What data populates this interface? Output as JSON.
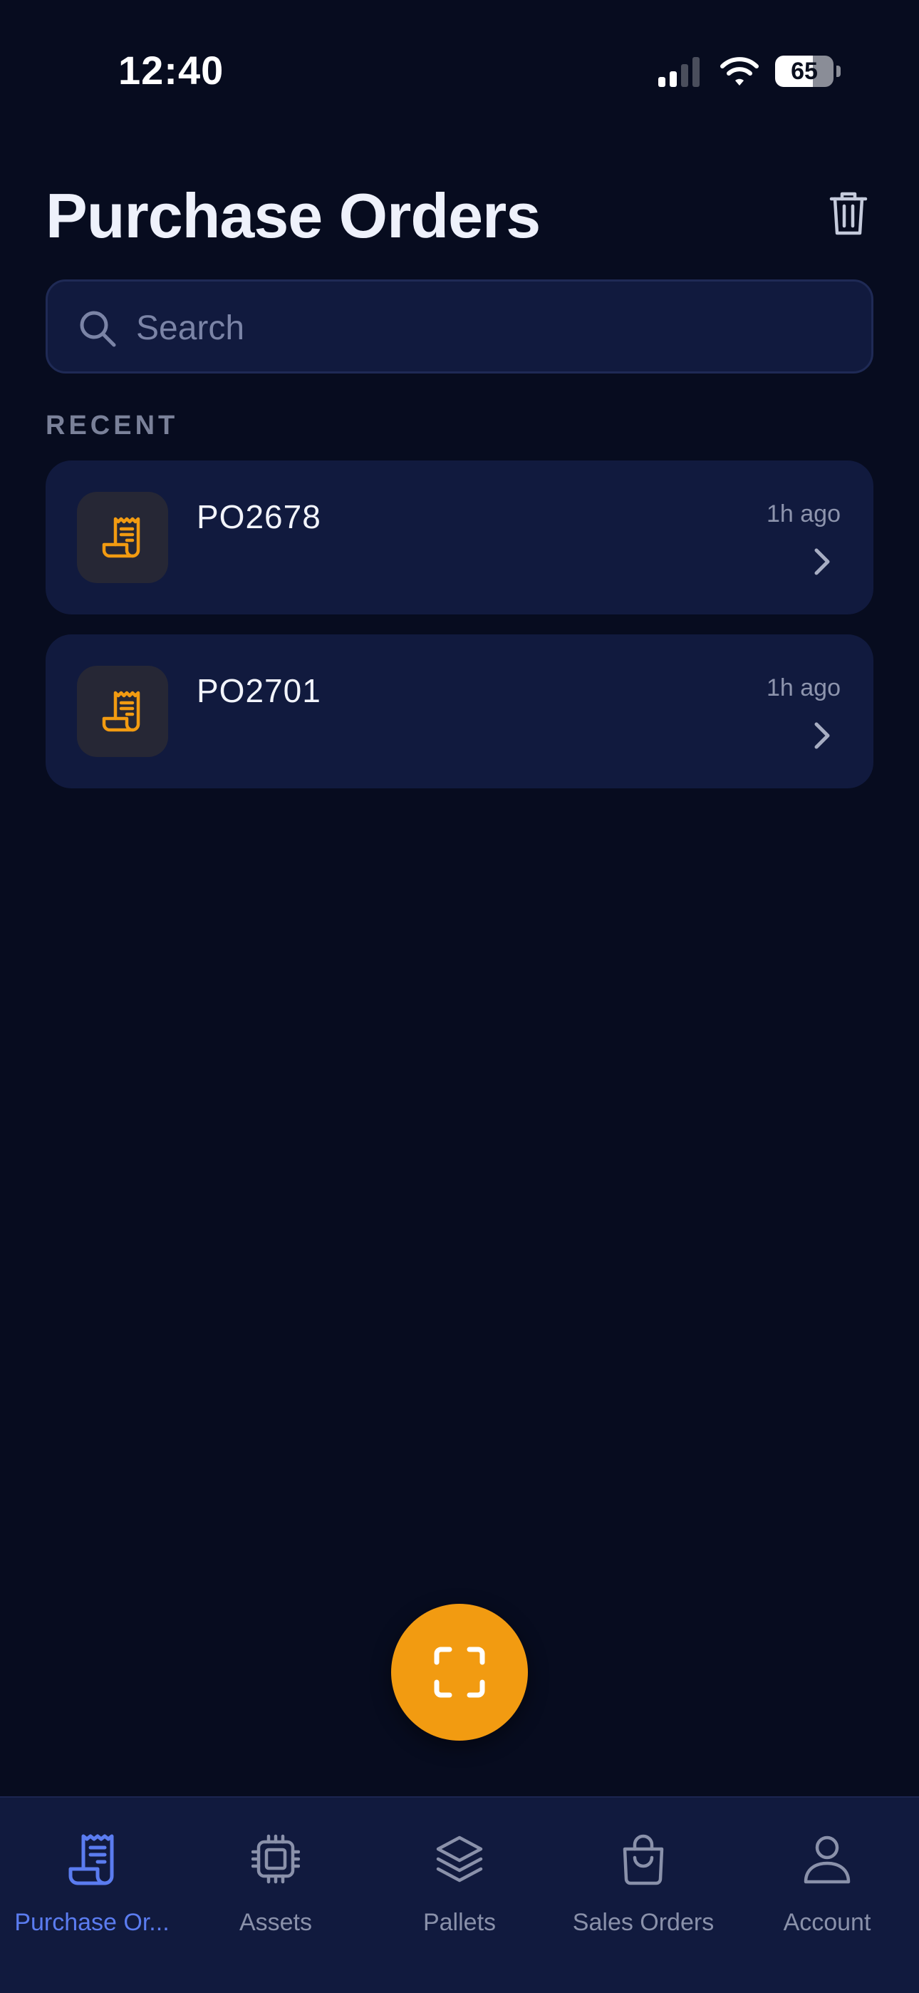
{
  "status_bar": {
    "time": "12:40",
    "battery_level": "65",
    "battery_fraction": 0.65
  },
  "header": {
    "title": "Purchase Orders",
    "trash_icon": "trash-icon"
  },
  "search": {
    "placeholder": "Search",
    "value": ""
  },
  "recent": {
    "label": "RECENT",
    "items": [
      {
        "id": "PO2678",
        "time": "1h ago",
        "icon": "receipt-icon"
      },
      {
        "id": "PO2701",
        "time": "1h ago",
        "icon": "receipt-icon"
      }
    ]
  },
  "fab": {
    "icon": "scan-icon"
  },
  "tabs": [
    {
      "label": "Purchase Or...",
      "icon": "receipt-icon",
      "active": true
    },
    {
      "label": "Assets",
      "icon": "chip-icon",
      "active": false
    },
    {
      "label": "Pallets",
      "icon": "layers-icon",
      "active": false
    },
    {
      "label": "Sales Orders",
      "icon": "shopping-bag-icon",
      "active": false
    },
    {
      "label": "Account",
      "icon": "user-icon",
      "active": false
    }
  ],
  "colors": {
    "background": "#070c1f",
    "card": "#111a3e",
    "accent_orange": "#f29b11",
    "active_tab": "#5b7cf0",
    "muted_text": "#8a91aa"
  }
}
